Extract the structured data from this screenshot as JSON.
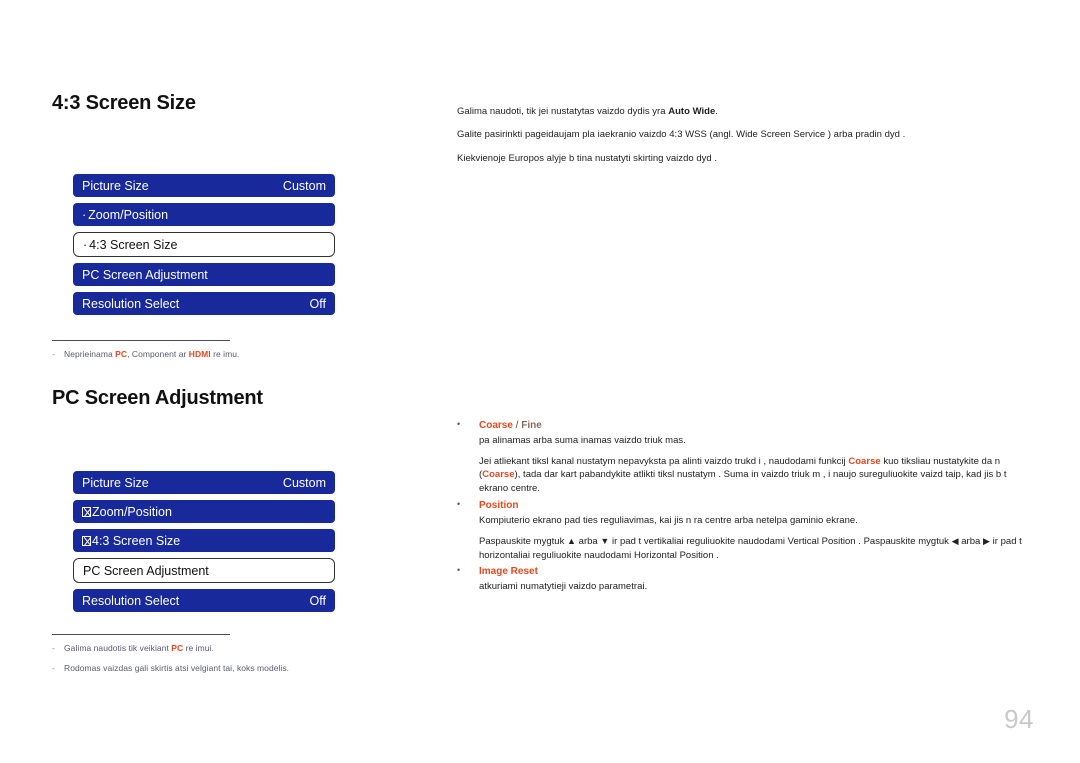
{
  "page": {
    "number": "94"
  },
  "sections": [
    {
      "heading": "4:3 Screen Size",
      "menu": [
        {
          "prefix": "",
          "tofu": false,
          "label": "Picture Size",
          "value": "Custom",
          "selected": false
        },
        {
          "prefix": "·",
          "tofu": false,
          "label": "Zoom/Position",
          "value": "",
          "selected": false
        },
        {
          "prefix": "·",
          "tofu": false,
          "label": "4:3 Screen Size",
          "value": "",
          "selected": true
        },
        {
          "prefix": "",
          "tofu": false,
          "label": "PC Screen Adjustment",
          "value": "",
          "selected": false
        },
        {
          "prefix": "",
          "tofu": false,
          "label": "Resolution Select",
          "value": "Off",
          "selected": false
        }
      ],
      "footnotes": [
        {
          "dash": "-",
          "segments": [
            {
              "text": "Neprieinama ",
              "style": "plain"
            },
            {
              "text": "PC",
              "style": "red"
            },
            {
              "text": ", Component ar ",
              "style": "plain"
            },
            {
              "text": "HDMI",
              "style": "red"
            },
            {
              "text": " re imu.",
              "style": "plain"
            }
          ]
        }
      ]
    },
    {
      "heading": "PC Screen Adjustment",
      "menu": [
        {
          "prefix": "",
          "tofu": false,
          "label": "Picture Size",
          "value": "Custom",
          "selected": false
        },
        {
          "prefix": "",
          "tofu": true,
          "label": "Zoom/Position",
          "value": "",
          "selected": false
        },
        {
          "prefix": "",
          "tofu": true,
          "label": "4:3 Screen Size",
          "value": "",
          "selected": false
        },
        {
          "prefix": "",
          "tofu": false,
          "label": "PC Screen Adjustment",
          "value": "",
          "selected": true
        },
        {
          "prefix": "",
          "tofu": false,
          "label": "Resolution Select",
          "value": "Off",
          "selected": false
        }
      ],
      "footnotes": [
        {
          "dash": "-",
          "segments": [
            {
              "text": "Galima naudotis tik veikiant ",
              "style": "plain"
            },
            {
              "text": "PC",
              "style": "red"
            },
            {
              "text": " re imui.",
              "style": "plain"
            }
          ]
        },
        {
          "dash": "-",
          "segments": [
            {
              "text": "Rodomas vaizdas gali skirtis atsi velgiant  tai, koks modelis.",
              "style": "plain"
            }
          ]
        }
      ]
    }
  ],
  "right_column": {
    "intro": [
      [
        {
          "text": "Galima naudoti, tik jei nustatytas vaizdo dydis yra ",
          "style": "plain"
        },
        {
          "text": "Auto Wide",
          "style": "bold"
        },
        {
          "text": ".",
          "style": "plain"
        }
      ],
      [
        {
          "text": "Galite pasirinkti pageidaujam  pla iaekranio vaizdo 4:3 WSS (angl. Wide Screen Service ) arba pradin  dyd .",
          "style": "plain"
        }
      ],
      [
        {
          "text": "Kiekvienoje Europos  alyje b  tina nustatyti skirting  vaizdo dyd .",
          "style": "plain"
        }
      ]
    ],
    "features": [
      {
        "bullet": "•",
        "title_segments": [
          {
            "text": "Coarse",
            "style": "red"
          },
          {
            "text": " / ",
            "style": "sep"
          },
          {
            "text": "Fine",
            "style": "alt"
          }
        ],
        "paragraphs": [
          [
            {
              "text": "pa alinamas arba suma inamas vaizdo triuk mas.",
              "style": "plain"
            }
          ],
          [
            {
              "text": "Jei atliekant tiksl  kanal  nustatym  nepavyksta pa alinti vaizdo trukd i , naudodami funkcij  ",
              "style": "plain"
            },
            {
              "text": "Coarse",
              "style": "kw"
            },
            {
              "text": " kuo tiksliau nustatykite da n  (",
              "style": "plain"
            },
            {
              "text": "Coarse",
              "style": "kw"
            },
            {
              "text": "), tada dar kart  pabandykite atlikti tiksl  nustatym . Suma in  vaizdo triuk m , i  naujo sureguliuokite vaizd  taip, kad jis b t  ekrano centre.",
              "style": "plain"
            }
          ]
        ]
      },
      {
        "bullet": "•",
        "title_segments": [
          {
            "text": "Position",
            "style": "red"
          }
        ],
        "paragraphs": [
          [
            {
              "text": "Kompiuterio ekrano pad ties reguliavimas, kai jis n ra centre arba netelpa gaminio ekrane.",
              "style": "plain"
            }
          ],
          [
            {
              "text": "Paspauskite mygtuk  ",
              "style": "plain"
            },
            {
              "text": "▲",
              "style": "arrow"
            },
            {
              "text": " arba ",
              "style": "plain"
            },
            {
              "text": "▼",
              "style": "arrow"
            },
            {
              "text": " ir pad t  vertikaliai reguliuokite naudodami  Vertical Position . Paspauskite mygtuk  ",
              "style": "plain"
            },
            {
              "text": "◀",
              "style": "arrow"
            },
            {
              "text": " arba ",
              "style": "plain"
            },
            {
              "text": "▶",
              "style": "arrow"
            },
            {
              "text": " ir pad t  horizontaliai reguliuokite naudodami  Horizontal Position .",
              "style": "plain"
            }
          ]
        ]
      },
      {
        "bullet": "•",
        "title_segments": [
          {
            "text": "Image Reset",
            "style": "red"
          }
        ],
        "paragraphs": [
          [
            {
              "text": "atkuriami numatytieji vaizdo parametrai.",
              "style": "plain"
            }
          ]
        ]
      }
    ]
  },
  "colors": {
    "osd_blue": "#17299b",
    "accent_red": "#e8481c",
    "footnote_gray": "#5a5a72",
    "page_number_gray": "#c9c9c9"
  }
}
